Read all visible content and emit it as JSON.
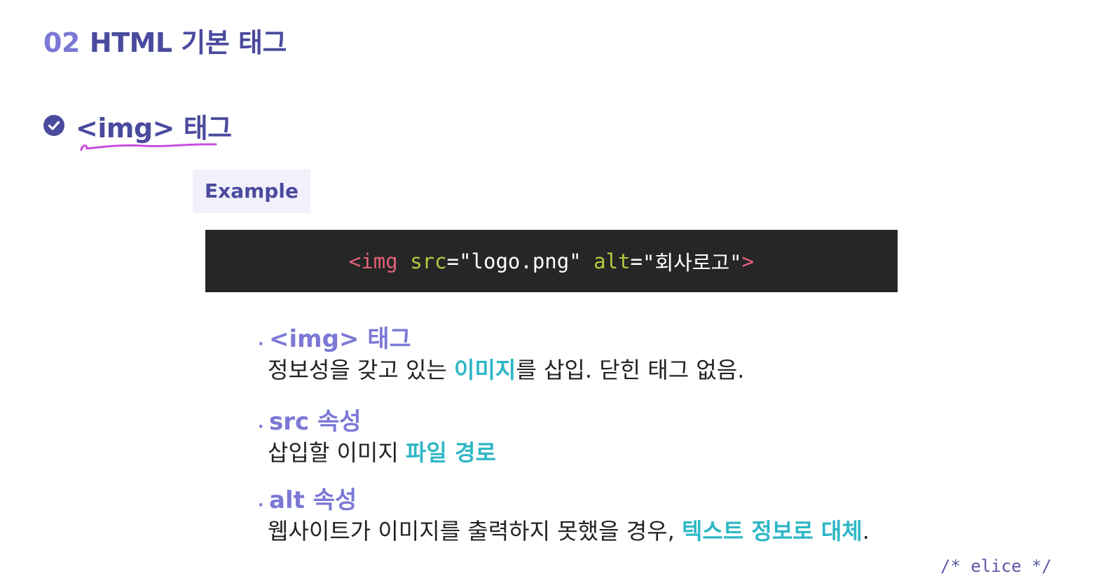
{
  "header": {
    "section_number": "02",
    "section_title": "HTML 기본 태그"
  },
  "topic": {
    "icon": "check-circle-icon",
    "title": "<img> 태그"
  },
  "example": {
    "label": "Example"
  },
  "code": {
    "tag_open": "<img",
    "attr_src": "src",
    "eq1": "=",
    "src_value": "\"logo.png\"",
    "attr_alt": "alt",
    "eq2": "=",
    "alt_value": "\"회사로고\"",
    "tag_close": ">"
  },
  "bullets": [
    {
      "title": "<img> 태그",
      "body_before": "정보성을 갖고 있는 ",
      "body_highlight": "이미지",
      "body_after": "를 삽입. 닫힌 태그 없음."
    },
    {
      "title": "src 속성",
      "body_before": "삽입할 이미지 ",
      "body_highlight": "파일 경로",
      "body_after": ""
    },
    {
      "title": "alt 속성",
      "body_before": "웹사이트가 이미지를 출력하지 못했을 경우, ",
      "body_highlight": "텍스트 정보로 대체",
      "body_after": "."
    }
  ],
  "bullet_dot": "·",
  "brand": {
    "logo_text": "/* elice */"
  },
  "colors": {
    "title": "#4a4a9e",
    "accent": "#7b78d6",
    "highlight": "#2fb7c6",
    "code_bg": "#262626",
    "code_tag": "#e3617a",
    "code_attr": "#b5c93e",
    "underline": "#c94fe0"
  }
}
